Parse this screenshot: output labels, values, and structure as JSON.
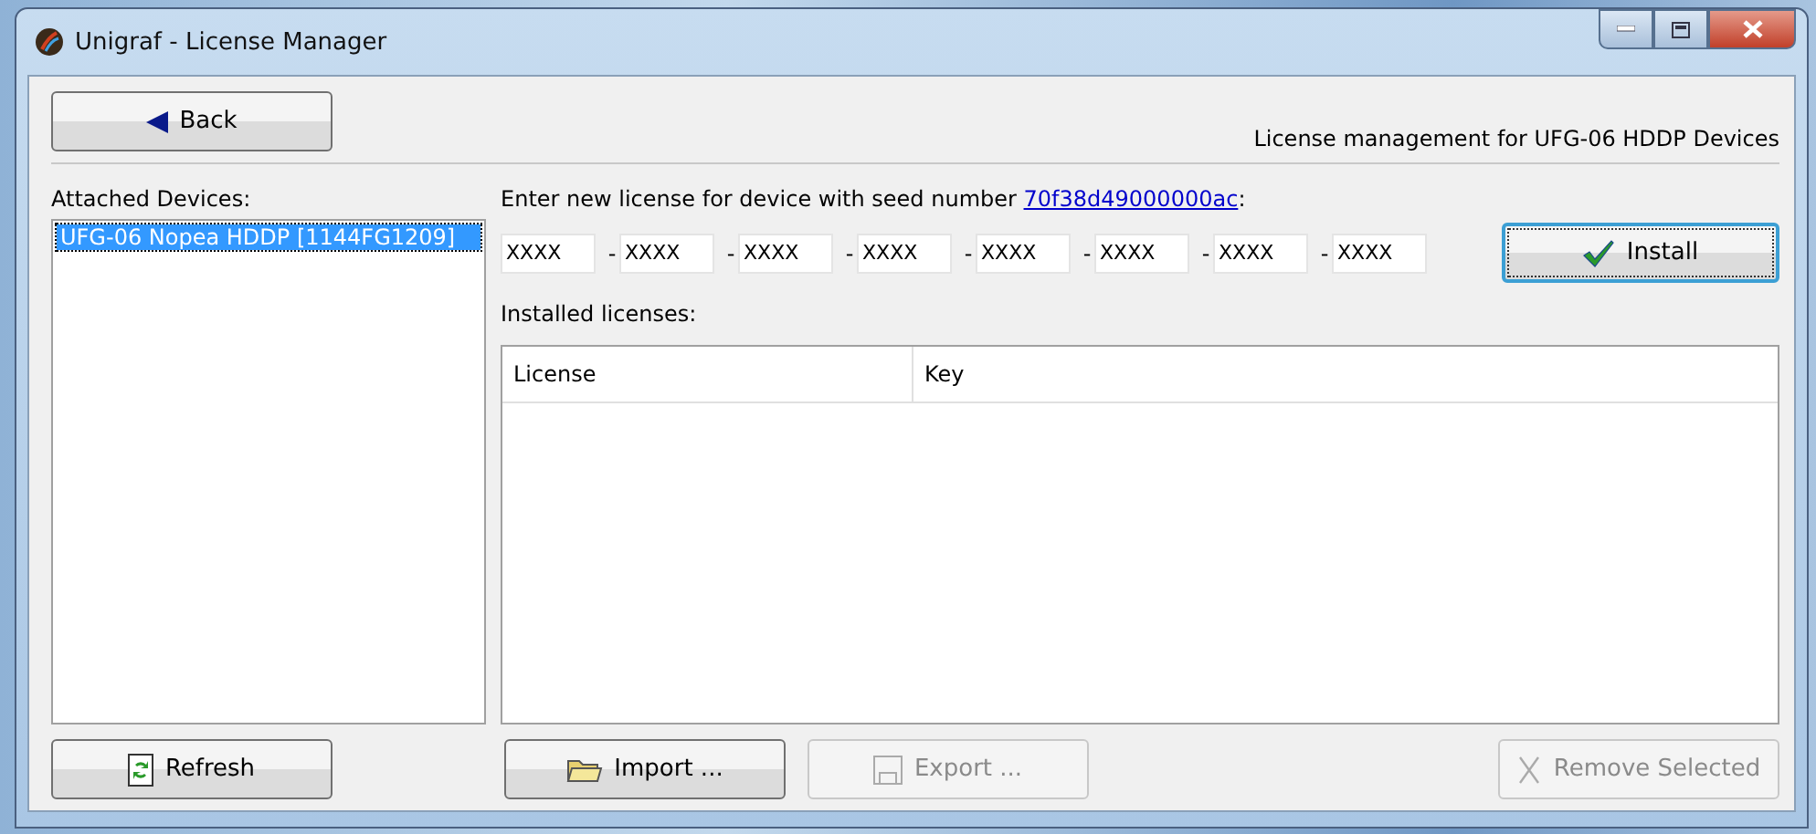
{
  "window": {
    "title": "Unigraf - License Manager"
  },
  "back_button": {
    "label": "Back"
  },
  "header": "License management for UFG-06 HDDP Devices",
  "devices": {
    "label": "Attached Devices:",
    "items": [
      {
        "name": "UFG-06 Nopea HDDP [1144FG1209]",
        "selected": true
      }
    ]
  },
  "license_entry": {
    "label": "Enter new license for device with seed number ",
    "seed": "70f38d49000000ac",
    "label_end": ":",
    "fields": [
      {
        "value": "XXXX"
      },
      {
        "prefix": "-",
        "value": "XXXX"
      },
      {
        "prefix": "-",
        "value": "XXXX"
      },
      {
        "prefix": "-",
        "value": "XXXX"
      },
      {
        "prefix": "-",
        "value": "XXXX"
      },
      {
        "prefix": "-",
        "value": "XXXX"
      },
      {
        "prefix": "-",
        "value": "XXXX"
      },
      {
        "prefix": "-",
        "value": "XXXX"
      }
    ],
    "install_button": {
      "label": "Install",
      "focused": true
    }
  },
  "installed": {
    "label": "Installed licenses:",
    "columns": [
      "License",
      "Key"
    ]
  },
  "buttons": [
    {
      "kind": "refresh",
      "label": "Refresh",
      "disabled": false
    },
    {
      "kind": "import",
      "label": "Import ...",
      "disabled": false
    },
    {
      "kind": "export",
      "label": "Export ...",
      "disabled": true
    },
    {
      "kind": "remove",
      "label": "Remove Selected",
      "disabled": true
    }
  ]
}
